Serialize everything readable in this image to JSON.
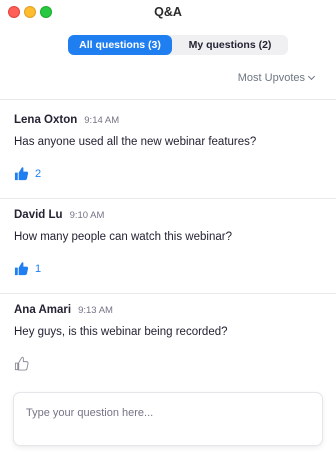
{
  "window": {
    "title": "Q&A"
  },
  "tabs": [
    {
      "label": "All questions (3)",
      "active": true
    },
    {
      "label": "My questions (2)",
      "active": false
    }
  ],
  "sort": {
    "label": "Most Upvotes"
  },
  "questions": [
    {
      "author": "Lena Oxton",
      "time": "9:14 AM",
      "text": "Has anyone used all the new webinar features?",
      "upvotes": "2",
      "upvoted": true
    },
    {
      "author": "David Lu",
      "time": "9:10 AM",
      "text": "How many people can watch this webinar?",
      "upvotes": "1",
      "upvoted": true
    },
    {
      "author": "Ana Amari",
      "time": "9:13 AM",
      "text": "Hey guys, is this webinar being recorded?",
      "upvotes": "",
      "upvoted": false
    }
  ],
  "compose": {
    "placeholder": "Type your question here..."
  },
  "colors": {
    "accent": "#1f7ff1",
    "muted": "#747487",
    "text": "#232333"
  },
  "icons": {
    "upvote": "thumbs-up-icon"
  }
}
